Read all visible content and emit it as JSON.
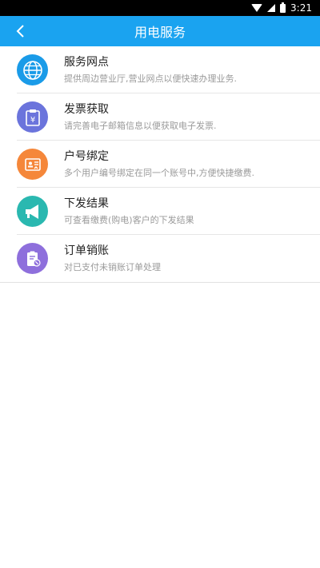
{
  "status_bar": {
    "time": "3:21"
  },
  "header": {
    "title": "用电服务"
  },
  "colors": {
    "header_bg": "#1aa3f0",
    "globe": "#1a9be8",
    "invoice": "#6b74dc",
    "account": "#f5873a",
    "announce": "#2ab8b0",
    "order": "#8e6fdc"
  },
  "items": [
    {
      "icon": "globe-icon",
      "title": "服务网点",
      "desc": "提供周边营业厅,营业网点以便快速办理业务."
    },
    {
      "icon": "invoice-icon",
      "title": "发票获取",
      "desc": "请完善电子邮箱信息以便获取电子发票."
    },
    {
      "icon": "id-card-icon",
      "title": "户号绑定",
      "desc": "多个用户编号绑定在同一个账号中,方便快捷缴费."
    },
    {
      "icon": "megaphone-icon",
      "title": "下发结果",
      "desc": "可查看缴费(购电)客户的下发结果"
    },
    {
      "icon": "order-icon",
      "title": "订单销账",
      "desc": "对已支付未销账订单处理"
    }
  ]
}
